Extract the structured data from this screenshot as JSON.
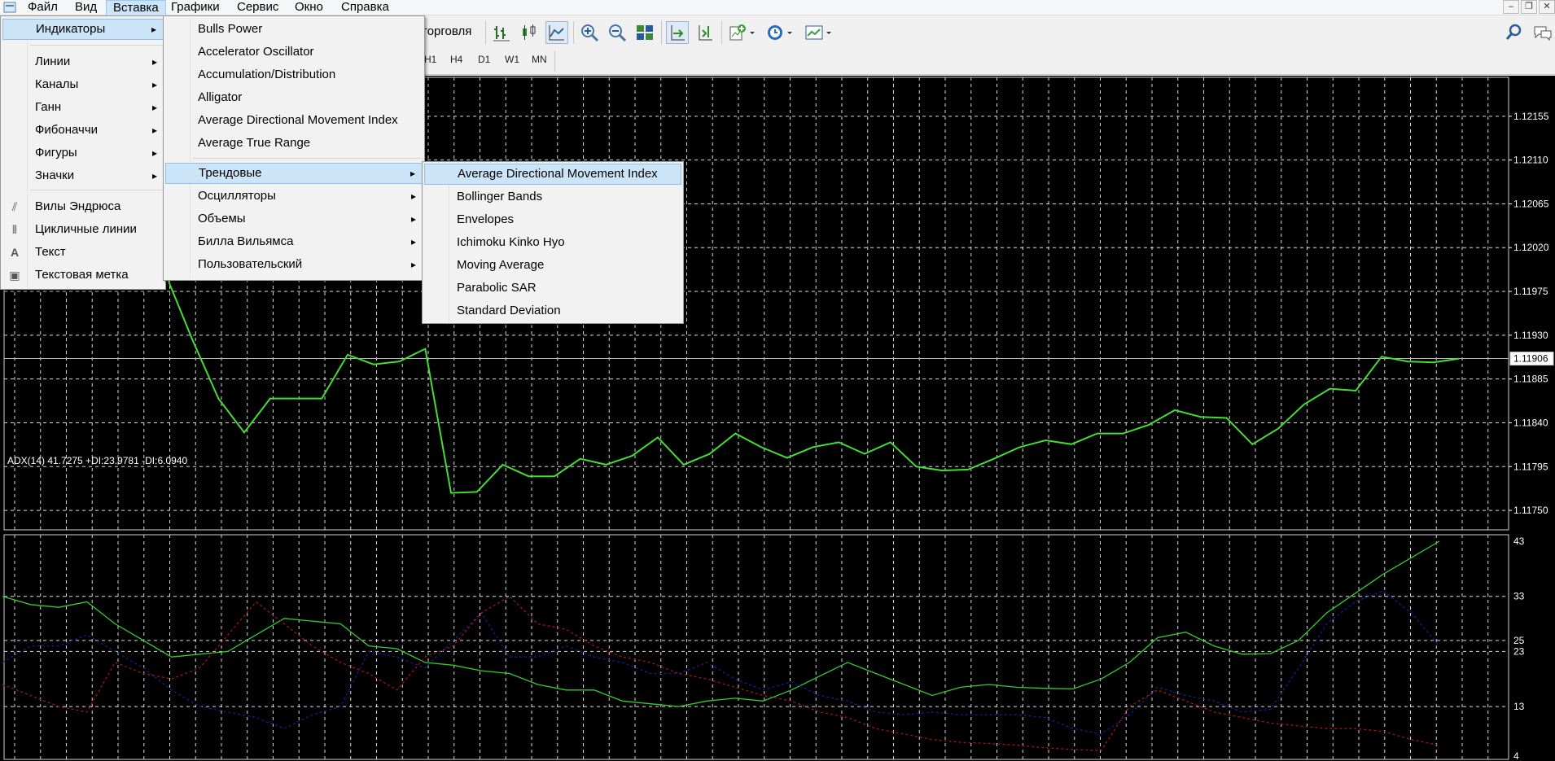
{
  "menubar": {
    "items": [
      "Файл",
      "Вид",
      "Вставка",
      "Графики",
      "Сервис",
      "Окно",
      "Справка"
    ],
    "active_index": 2
  },
  "toolbar": {
    "trade_label": "торговля"
  },
  "timeframes": [
    "H1",
    "H4",
    "D1",
    "W1",
    "MN"
  ],
  "insert_menu": {
    "items": [
      {
        "label": "Индикаторы",
        "submenu": true,
        "highlighted": true
      },
      {
        "label": "Линии",
        "submenu": true
      },
      {
        "label": "Каналы",
        "submenu": true
      },
      {
        "label": "Ганн",
        "submenu": true
      },
      {
        "label": "Фибоначчи",
        "submenu": true
      },
      {
        "label": "Фигуры",
        "submenu": true
      },
      {
        "label": "Значки",
        "submenu": true
      },
      {
        "label": "Вилы Эндрюса",
        "icon": "andrews-pitchfork-icon"
      },
      {
        "label": "Цикличные линии",
        "icon": "cycle-lines-icon"
      },
      {
        "label": "Текст",
        "icon": "text-icon"
      },
      {
        "label": "Текстовая метка",
        "icon": "text-label-icon"
      }
    ]
  },
  "indicators_menu": {
    "items": [
      {
        "label": "Bulls Power"
      },
      {
        "label": "Accelerator Oscillator"
      },
      {
        "label": "Accumulation/Distribution"
      },
      {
        "label": "Alligator"
      },
      {
        "label": "Average Directional Movement Index"
      },
      {
        "label": "Average True Range"
      },
      {
        "label": "Трендовые",
        "submenu": true,
        "highlighted": true
      },
      {
        "label": "Осцилляторы",
        "submenu": true
      },
      {
        "label": "Объемы",
        "submenu": true
      },
      {
        "label": "Билла Вильямса",
        "submenu": true
      },
      {
        "label": "Пользовательский",
        "submenu": true
      }
    ]
  },
  "trend_menu": {
    "items": [
      {
        "label": "Average Directional Movement Index",
        "highlighted": true
      },
      {
        "label": "Bollinger Bands"
      },
      {
        "label": "Envelopes"
      },
      {
        "label": "Ichimoku Kinko Hyo"
      },
      {
        "label": "Moving Average"
      },
      {
        "label": "Parabolic SAR"
      },
      {
        "label": "Standard Deviation"
      }
    ]
  },
  "chart": {
    "current_price": "1.11906",
    "price_ticks": [
      "1.12155",
      "1.12110",
      "1.12065",
      "1.12020",
      "1.11975",
      "1.11930",
      "1.11885",
      "1.11840",
      "1.11795",
      "1.11750"
    ],
    "adx_label": "ADX(14) 41.7275 +DI:23.9781 -DI:6.0940",
    "adx_ticks": [
      "43",
      "33",
      "25",
      "23",
      "13",
      "4"
    ],
    "colors": {
      "price_line": "#44dd33",
      "adx": "#33cc33",
      "plus_di": "#1a1a9a",
      "minus_di": "#a31515",
      "grid": "#ffffff"
    }
  },
  "chart_data": [
    {
      "type": "line",
      "title": "",
      "ylim": [
        1.1173,
        1.12195
      ],
      "series": [
        {
          "values": [
            1.1203,
            1.1199,
            1.11925,
            1.11865,
            1.1183,
            1.11865,
            1.11865,
            1.11865,
            1.1191,
            1.119,
            1.11903,
            1.11916,
            1.11768,
            1.11769,
            1.11797,
            1.11785,
            1.11785,
            1.11803,
            1.11797,
            1.11806,
            1.11825,
            1.11797,
            1.11808,
            1.11829,
            1.11815,
            1.11804,
            1.11815,
            1.1182,
            1.11808,
            1.1182,
            1.11795,
            1.11791,
            1.11792,
            1.11803,
            1.11815,
            1.11822,
            1.11818,
            1.11829,
            1.11829,
            1.11838,
            1.11853,
            1.11846,
            1.11845,
            1.11818,
            1.11834,
            1.11859,
            1.11875,
            1.11873,
            1.11908,
            1.11903,
            1.11902,
            1.11906
          ]
        }
      ]
    },
    {
      "type": "line",
      "title": "ADX(14) 41.7275 +DI:23.9781 -DI:6.0940",
      "ylim": [
        4,
        43
      ],
      "series": [
        {
          "name": "ADX",
          "values": [
            33,
            31.5,
            31,
            32,
            28,
            25,
            22,
            22.5,
            23,
            26,
            29,
            28.5,
            28,
            24,
            23.5,
            21,
            20.5,
            19.5,
            19,
            17,
            16,
            16,
            14,
            13.5,
            13,
            14,
            14.5,
            14,
            16,
            18.5,
            21,
            19,
            17,
            15,
            16.5,
            17,
            16.5,
            16.3,
            16.2,
            18,
            21,
            25.5,
            26.5,
            24,
            22.5,
            22.6,
            25,
            30,
            33.5,
            37,
            40,
            43
          ]
        },
        {
          "name": "+DI",
          "values": [
            21,
            24,
            24,
            26,
            23,
            20,
            16,
            13,
            12,
            11,
            9,
            11.5,
            13,
            23,
            22,
            20,
            25,
            30,
            22,
            22,
            24,
            22,
            21,
            19,
            19,
            21,
            18,
            16,
            17.5,
            15,
            14,
            12,
            11.5,
            12,
            11.5,
            11.5,
            11.5,
            11,
            9,
            8,
            11.5,
            16.5,
            15,
            14,
            12,
            12.5,
            20,
            28,
            32,
            34,
            30,
            24
          ]
        },
        {
          "name": "-DI",
          "values": [
            17,
            15,
            13,
            12,
            21,
            19,
            18,
            20,
            26,
            32,
            28,
            24,
            21,
            19,
            16,
            22,
            24,
            30,
            33,
            28,
            27,
            24,
            22,
            21,
            19,
            18,
            16.5,
            15,
            14,
            12,
            11,
            9,
            8,
            7,
            6.5,
            6.3,
            6,
            5.5,
            5.2,
            5,
            13,
            16,
            14,
            12,
            11,
            10,
            9.5,
            9,
            9,
            8.5,
            7,
            6
          ]
        }
      ]
    }
  ]
}
